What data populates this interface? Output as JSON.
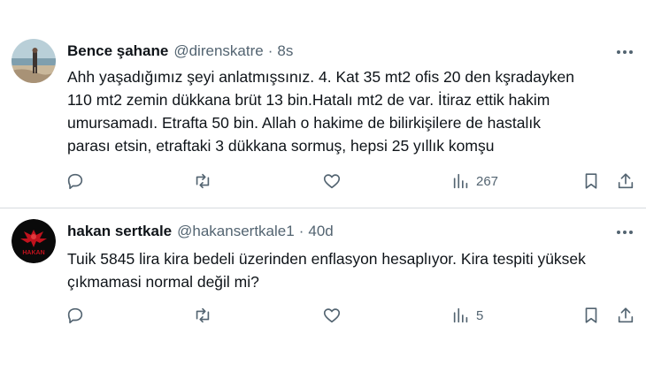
{
  "tweets": [
    {
      "author_name": "Bence şahane",
      "handle": "@direnskatre",
      "separator": "·",
      "time": "8s",
      "text": "Ahh yaşadığımız şeyi anlatmışsınız. 4. Kat 35 mt2 ofis 20 den kşradayken\n110 mt2 zemin dükkana brüt 13 bin.Hatalı mt2 de var. İtiraz ettik hakim\numursamadı. Etrafta 50 bin. Allah o hakime de bilirkişilere de hastalık\nparası etsin, etraftaki 3 dükkana sormuş, hepsi 25 yıllık komşu",
      "views": "267",
      "avatar_icon": "beach-photo-avatar"
    },
    {
      "author_name": "hakan sertkale",
      "handle": "@hakansertkale1",
      "separator": "·",
      "time": "40d",
      "text": "Tuik 5845 lira kira bedeli üzerinden enflasyon hesaplıyor. Kira tespiti yüksek\nçıkmamasi normal değil mi?",
      "views": "5",
      "avatar_icon": "hakan-logo-avatar",
      "avatar_text": "HAKAN"
    }
  ],
  "icons": {
    "reply": "reply-icon",
    "repost": "repost-icon",
    "like": "like-icon",
    "views": "views-icon",
    "bookmark": "bookmark-icon",
    "share": "share-icon",
    "more": "more-icon"
  },
  "colors": {
    "text": "#0f1419",
    "secondary": "#536471",
    "divider": "#d7dbdf",
    "avatar_red": "#c0121d"
  }
}
